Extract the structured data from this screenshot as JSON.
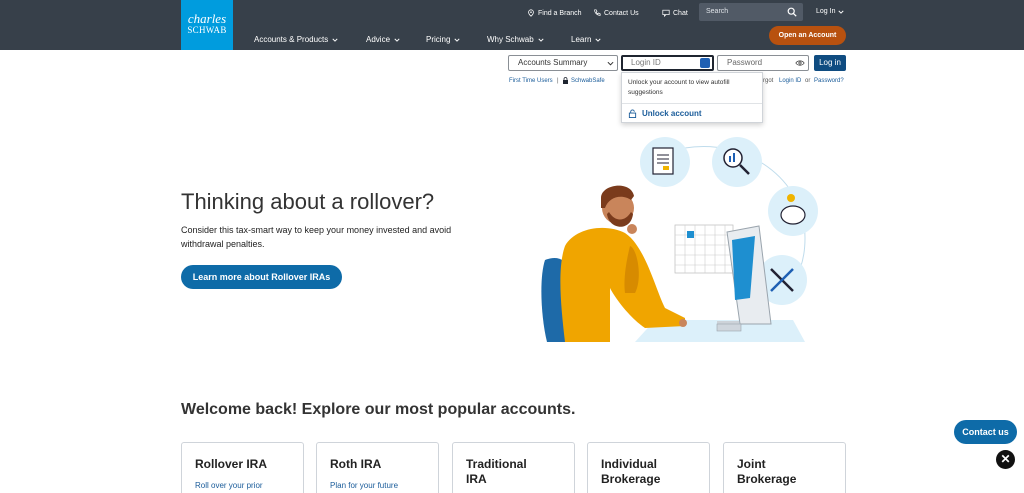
{
  "brand": {
    "line1": "charles",
    "line2": "SCHWAB"
  },
  "utility": {
    "find_branch": "Find a Branch",
    "contact_us": "Contact Us",
    "chat": "Chat",
    "search_placeholder": "Search",
    "login": "Log In"
  },
  "nav": {
    "items": [
      {
        "label": "Accounts & Products"
      },
      {
        "label": "Advice"
      },
      {
        "label": "Pricing"
      },
      {
        "label": "Why Schwab"
      },
      {
        "label": "Learn"
      }
    ],
    "open_account": "Open an Account"
  },
  "login_form": {
    "account_select": "Accounts Summary",
    "login_id_placeholder": "Login ID",
    "password_placeholder": "Password",
    "login_button": "Log in",
    "first_time_users": "First Time Users",
    "schwab_safe": "SchwabSafe",
    "forgot_prefix": "rgot",
    "forgot_login_id": "Login ID",
    "or": "or",
    "forgot_password": "Password?"
  },
  "autofill_popup": {
    "message": "Unlock your account to view autofill suggestions",
    "unlock": "Unlock account"
  },
  "hero": {
    "title": "Thinking about a rollover?",
    "subtitle": "Consider this tax-smart way to keep your money invested and avoid withdrawal penalties.",
    "cta": "Learn more about Rollover IRAs"
  },
  "accounts": {
    "heading": "Welcome back! Explore our most popular accounts.",
    "cards": [
      {
        "title": "Rollover IRA",
        "desc": "Roll over your prior"
      },
      {
        "title": "Roth IRA",
        "desc": "Plan for your future"
      },
      {
        "title_line1": "Traditional",
        "title_line2": "IRA"
      },
      {
        "title_line1": "Individual",
        "title_line2": "Brokerage"
      },
      {
        "title_line1": "Joint",
        "title_line2": "Brokerage"
      }
    ]
  },
  "floating": {
    "contact_us": "Contact us",
    "close": "✕"
  },
  "colors": {
    "header_bg": "#37404a",
    "brand_blue": "#009cde",
    "accent_orange": "#b8510f",
    "primary_blue": "#0e6ba8",
    "link_blue": "#1a5c9a"
  }
}
